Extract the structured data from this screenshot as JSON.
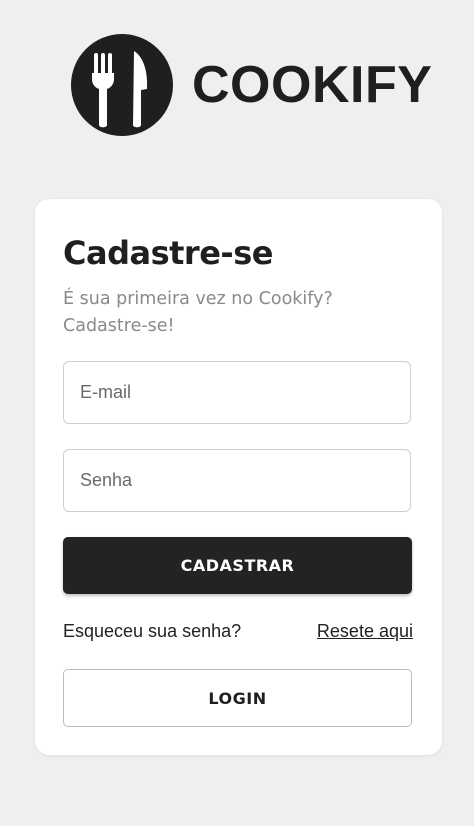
{
  "brand": {
    "name": "COOKIFY",
    "logo_icon": "fork-knife-icon",
    "color": "#1f1f1f"
  },
  "form": {
    "title": "Cadastre-se",
    "subtitle": "É sua primeira vez no Cookify? Cadastre-se!",
    "email": {
      "placeholder": "E-mail",
      "value": ""
    },
    "password": {
      "placeholder": "Senha",
      "value": ""
    },
    "submit_label": "CADASTRAR",
    "forgot_text": "Esqueceu sua senha?",
    "reset_link": "Resete aqui",
    "login_label": "LOGIN"
  },
  "colors": {
    "background": "#efefef",
    "card": "#ffffff",
    "primary_button": "#232323",
    "subtitle_text": "#8a8a8a"
  }
}
